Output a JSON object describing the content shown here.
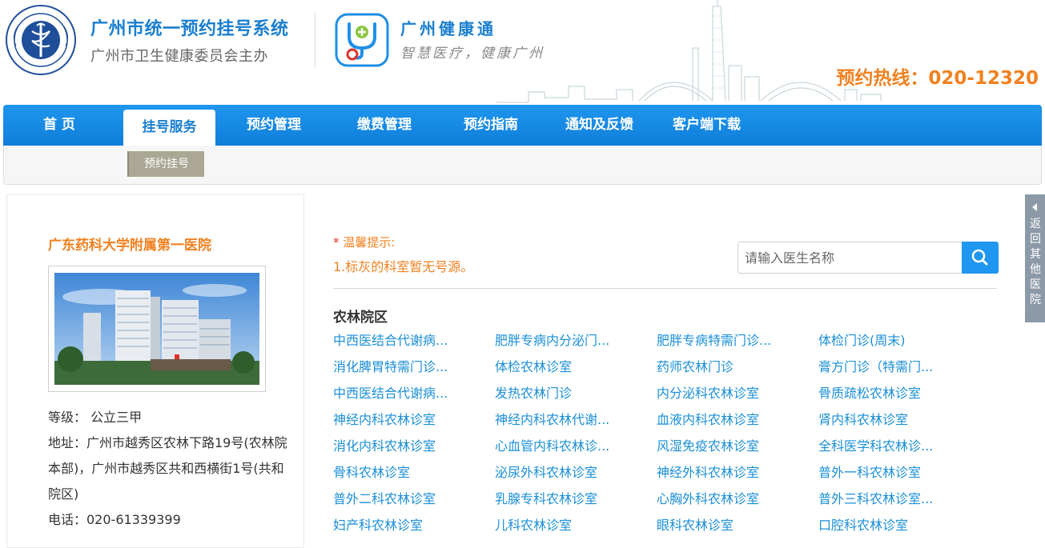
{
  "header": {
    "system_title": "广州市统一预约挂号系统",
    "system_subtitle": "广州市卫生健康委员会主办",
    "health_name": "广州健康通",
    "health_slogan": "智慧医疗，健康广州",
    "hotline": "预约热线：020-12320",
    "brand_color": "#1a7fd0",
    "accent_color": "#f08120"
  },
  "nav": {
    "items": [
      {
        "label": "首 页"
      },
      {
        "label": "挂号服务",
        "active": true
      },
      {
        "label": "预约管理"
      },
      {
        "label": "缴费管理"
      },
      {
        "label": "预约指南"
      },
      {
        "label": "通知及反馈"
      },
      {
        "label": "客户端下载"
      }
    ],
    "sub_item": "预约挂号"
  },
  "hospital": {
    "name": "广东药科大学附属第一医院",
    "grade": "等级： 公立三甲",
    "address": "地址：广州市越秀区农林下路19号(农林院本部)，广州市越秀区共和西横街1号(共和院区)",
    "phone": "电话：020-61339399"
  },
  "tips": {
    "title": "温馨提示:",
    "line1": "1.标灰的科室暂无号源。"
  },
  "search": {
    "placeholder": "请输入医生名称"
  },
  "campus": {
    "name": "农林院区",
    "departments": [
      "中西医结合代谢病...",
      "肥胖专病内分泌门...",
      "肥胖专病特需门诊...",
      "体检门诊(周末)",
      "消化脾胃特需门诊...",
      "体检农林诊室",
      "药师农林门诊",
      "膏方门诊（特需门...",
      "中西医结合代谢病...",
      "发热农林门诊",
      "内分泌科农林诊室",
      "骨质疏松农林诊室",
      "神经内科农林诊室",
      "神经内科农林代谢...",
      "血液内科农林诊室",
      "肾内科农林诊室",
      "消化内科农林诊室",
      "心血管内科农林诊...",
      "风湿免疫农林诊室",
      "全科医学科农林诊...",
      "骨科农林诊室",
      "泌尿外科农林诊室",
      "神经外科农林诊室",
      "普外一科农林诊室",
      "普外二科农林诊室",
      "乳腺专科农林诊室",
      "心胸外科农林诊室",
      "普外三科农林诊室...",
      "妇产科农林诊室",
      "儿科农林诊室",
      "眼科农林诊室",
      "口腔科农林诊室"
    ]
  },
  "side_tab": {
    "label": "返回其他医院"
  }
}
